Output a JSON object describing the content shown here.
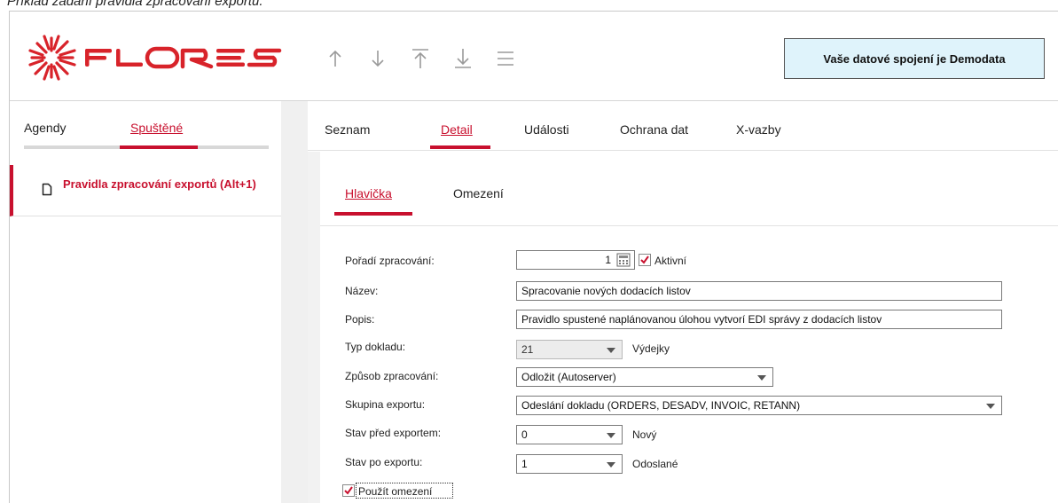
{
  "caption": "Príklad zadaní pravidla zpracování exportu.",
  "header": {
    "logo_text": "FLORES",
    "connection": "Vaše datové spojení je Demodata",
    "toolbar": [
      {
        "icon": "arrow-up-icon"
      },
      {
        "icon": "arrow-down-icon"
      },
      {
        "icon": "arrow-to-top-icon"
      },
      {
        "icon": "arrow-to-bottom-icon"
      },
      {
        "icon": "menu-icon"
      }
    ]
  },
  "left": {
    "tabs": [
      {
        "label": "Agendy",
        "active": false
      },
      {
        "label": "Spuštěné",
        "active": true
      }
    ],
    "items": [
      {
        "label": "Pravidla zpracování exportů (Alt+1)",
        "icon": "document-icon"
      }
    ]
  },
  "right": {
    "tabs": [
      {
        "label": "Seznam",
        "active": false
      },
      {
        "label": "Detail",
        "active": true
      },
      {
        "label": "Události",
        "active": false
      },
      {
        "label": "Ochrana dat",
        "active": false
      },
      {
        "label": "X-vazby",
        "active": false
      }
    ],
    "subtabs": [
      {
        "label": "Hlavička",
        "active": true
      },
      {
        "label": "Omezení",
        "active": false
      }
    ]
  },
  "form": {
    "poradi": {
      "label": "Pořadí zpracování:",
      "value": "1"
    },
    "aktivni": {
      "label": "Aktivní",
      "checked": true
    },
    "nazev": {
      "label": "Název:",
      "value": "Spracovanie nových dodacích listov"
    },
    "popis": {
      "label": "Popis:",
      "value": "Pravidlo spustené naplánovanou úlohou vytvorí EDI správy z dodacích listov"
    },
    "typ_dokladu": {
      "label": "Typ dokladu:",
      "value": "21",
      "description": "Výdejky"
    },
    "zpusob": {
      "label": "Způsob zpracování:",
      "value": "Odložit (Autoserver)"
    },
    "skupina": {
      "label": "Skupina exportu:",
      "value": "Odeslání dokladu (ORDERS, DESADV, INVOIC, RETANN)"
    },
    "stav_pred": {
      "label": "Stav před exportem:",
      "value": "0",
      "description": "Nový"
    },
    "stav_po": {
      "label": "Stav po exportu:",
      "value": "1",
      "description": "Odoslané"
    },
    "pouzit_omezeni": {
      "label": "Použít omezení",
      "checked": true
    }
  },
  "colors": {
    "accent": "#c8102e",
    "connection_bg": "#dff3fb"
  }
}
